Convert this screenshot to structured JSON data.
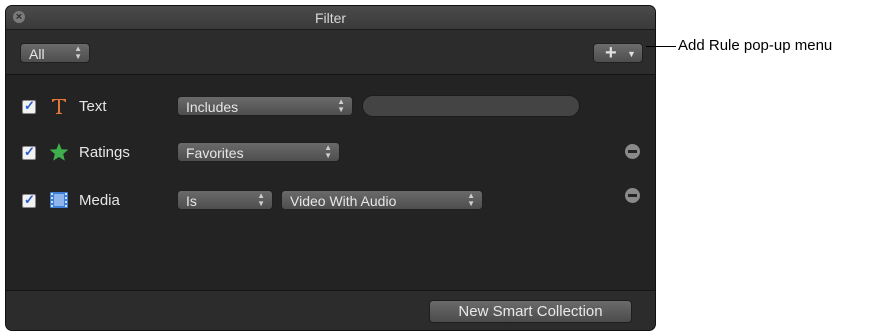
{
  "window": {
    "title": "Filter"
  },
  "toolbar": {
    "match_selector": "All",
    "add_rule_icon": "plus-icon"
  },
  "rules": [
    {
      "enabled": true,
      "icon": "text-T-icon",
      "label": "Text",
      "operator": "Includes",
      "value": ""
    },
    {
      "enabled": true,
      "icon": "star-icon",
      "label": "Ratings",
      "operator": "Favorites"
    },
    {
      "enabled": true,
      "icon": "film-strip-icon",
      "label": "Media",
      "operator": "Is",
      "value": "Video With Audio"
    }
  ],
  "footer": {
    "new_smart_collection_label": "New Smart Collection"
  },
  "callout": {
    "text": "Add Rule pop-up menu"
  },
  "colors": {
    "window_bg": "#262626",
    "text_icon": "#e0763a",
    "star_icon": "#3fae4c",
    "film_icon": "#3d7fd8",
    "checkmark": "#2a5fc9"
  }
}
